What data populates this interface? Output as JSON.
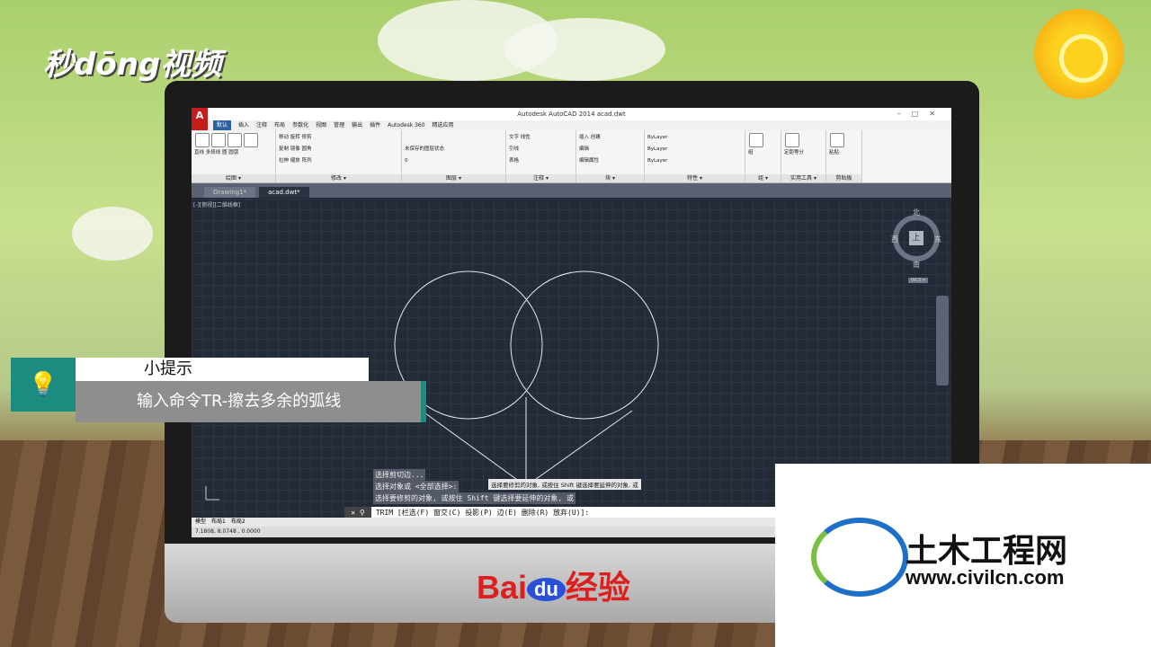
{
  "watermark": {
    "miaodong": "秒dōng视频"
  },
  "app": {
    "title": "Autodesk AutoCAD 2014    acad.dwt",
    "tabs": [
      "默认",
      "插入",
      "注释",
      "布局",
      "参数化",
      "视图",
      "管理",
      "输出",
      "插件",
      "Autodesk 360",
      "精选应用"
    ],
    "ribbon_groups": [
      {
        "title": "绘图 ▾",
        "items": [
          "直线",
          "多段线",
          "圆",
          "圆弧"
        ]
      },
      {
        "title": "修改 ▾",
        "items": [
          "移动",
          "旋转",
          "修剪",
          "复制",
          "镜像",
          "圆角",
          "拉伸",
          "缩放",
          "阵列"
        ]
      },
      {
        "title": "图层 ▾",
        "items": [
          "未保存的图层状态",
          "0"
        ]
      },
      {
        "title": "注释 ▾",
        "items": [
          "文字",
          "线性",
          "引线",
          "表格"
        ]
      },
      {
        "title": "块 ▾",
        "items": [
          "插入",
          "创建",
          "编辑",
          "编辑属性"
        ]
      },
      {
        "title": "特性 ▾",
        "items": [
          "ByLayer",
          "ByLayer",
          "ByLayer"
        ]
      },
      {
        "title": "组 ▾",
        "items": [
          "组"
        ]
      },
      {
        "title": "实用工具 ▾",
        "items": [
          "定距等分"
        ]
      },
      {
        "title": "剪贴板",
        "items": [
          "粘贴"
        ]
      }
    ],
    "doc_tabs": [
      "Drawing1*",
      "acad.dwt*"
    ],
    "view_label": "[-][俯视][二维线框]",
    "compass": {
      "north": "北",
      "south": "南",
      "east": "东",
      "west": "西",
      "top": "上",
      "wcs": "WCS ▾"
    },
    "command_history": [
      "选择剪切边...",
      "选择对象或 <全部选择>:",
      "选择要修剪的对象, 或按住 Shift 键选择要延伸的对象, 或"
    ],
    "tooltip": "选择要修剪的对象, 或按住 Shift 键选择要延伸的对象, 或",
    "command_line": "TRIM [栏选(F) 窗交(C) 投影(P) 边(E) 删除(R) 放弃(U)]:",
    "layout_tabs": [
      "模型",
      "布局1",
      "布局2"
    ],
    "status_coords": "7.1808,  8.0748 , 0.0000"
  },
  "tip": {
    "head": "小提示",
    "body": "输入命令TR-擦去多余的弧线"
  },
  "baidu": {
    "bai": "Bai",
    "du": "du",
    "jingyan": "经验"
  },
  "brand": {
    "cn": "土木工程网",
    "url": "www.civilcn.com"
  }
}
